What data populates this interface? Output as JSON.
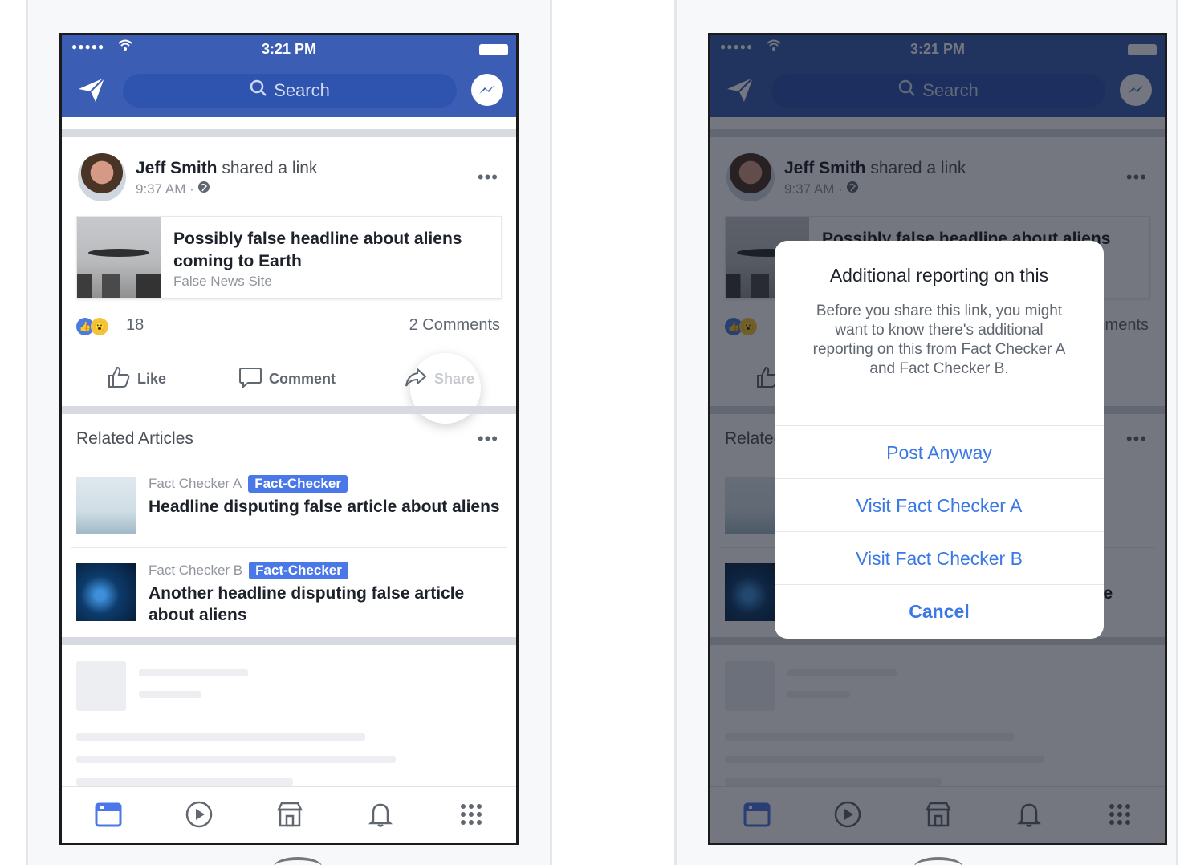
{
  "status_bar": {
    "time": "3:21 PM",
    "signal": "●●●●●"
  },
  "navbar": {
    "search_placeholder": "Search"
  },
  "post": {
    "author": "Jeff Smith",
    "action": "shared a link",
    "time": "9:37 AM · ",
    "link": {
      "title": "Possibly false headline about aliens coming to Earth",
      "source": "False News Site"
    },
    "reaction_count": "18",
    "comments": "2 Comments",
    "actions": {
      "like": "Like",
      "comment": "Comment",
      "share": "Share"
    }
  },
  "related": {
    "title": "Related Articles",
    "items": [
      {
        "source": "Fact Checker A",
        "badge": "Fact-Checker",
        "headline": "Headline disputing false article about aliens"
      },
      {
        "source": "Fact Checker B",
        "badge": "Fact-Checker",
        "headline": "Another headline disputing false article about aliens"
      }
    ]
  },
  "dialog": {
    "title": "Additional reporting on this",
    "body": "Before you share this link, you might want to know there's additional reporting on this from Fact Checker A and Fact Checker B.",
    "buttons": {
      "post_anyway": "Post Anyway",
      "visit_a": "Visit Fact Checker A",
      "visit_b": "Visit Fact Checker B",
      "cancel": "Cancel"
    }
  },
  "icons": [
    "send-icon",
    "search-icon",
    "messenger-icon",
    "globe-icon",
    "like-icon",
    "comment-icon",
    "share-icon",
    "news-feed-icon",
    "video-icon",
    "marketplace-icon",
    "notifications-icon",
    "menu-icon"
  ],
  "colors": {
    "brand_blue": "#3b5eb4",
    "link_blue": "#3a78e6",
    "badge_blue": "#4a78e8"
  }
}
